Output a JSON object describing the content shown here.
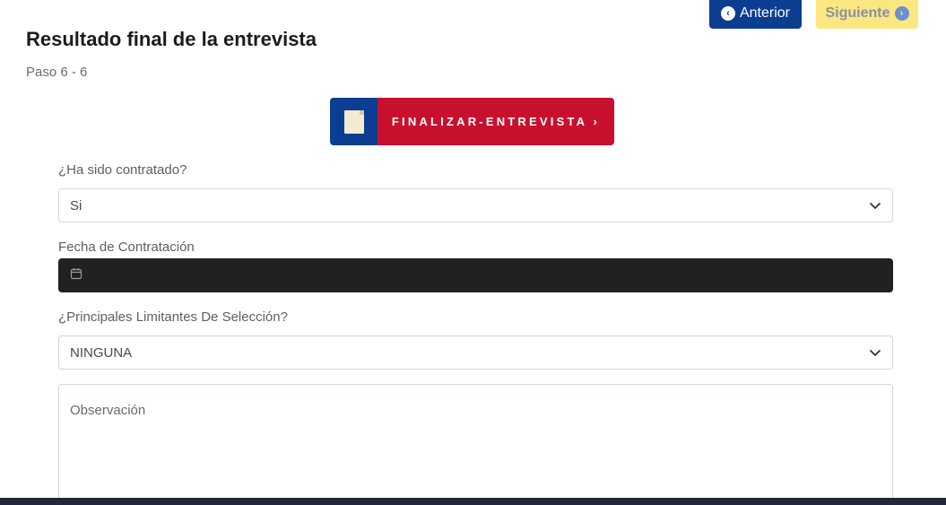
{
  "nav": {
    "prev_label": "Anterior",
    "next_label": "Siguiente"
  },
  "header": {
    "title": "Resultado final de la entrevista",
    "step": "Paso 6 - 6"
  },
  "finalize": {
    "label": "FINALIZAR-ENTREVISTA ›"
  },
  "form": {
    "hired": {
      "label": "¿Ha sido contratado?",
      "value": "Si"
    },
    "hire_date": {
      "label": "Fecha de Contratación",
      "value": ""
    },
    "limitations": {
      "label": "¿Principales Limitantes De Selección?",
      "value": "NINGUNA"
    },
    "observation": {
      "placeholder": "Observación"
    }
  },
  "colors": {
    "primary": "#0b3d91",
    "accent_yellow": "#fbe780",
    "finalize_red": "#c8102e",
    "date_input_bg": "#212121"
  }
}
